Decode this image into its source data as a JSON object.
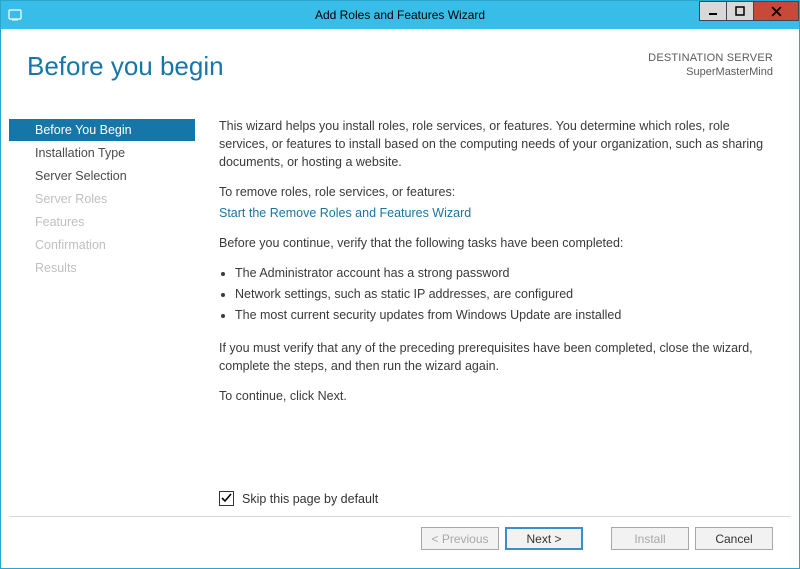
{
  "window": {
    "title": "Add Roles and Features Wizard"
  },
  "header": {
    "page_title": "Before you begin",
    "destination_label": "DESTINATION SERVER",
    "destination_value": "SuperMasterMind"
  },
  "nav": {
    "items": [
      {
        "label": "Before You Begin",
        "state": "selected"
      },
      {
        "label": "Installation Type",
        "state": "enabled"
      },
      {
        "label": "Server Selection",
        "state": "enabled"
      },
      {
        "label": "Server Roles",
        "state": "disabled"
      },
      {
        "label": "Features",
        "state": "disabled"
      },
      {
        "label": "Confirmation",
        "state": "disabled"
      },
      {
        "label": "Results",
        "state": "disabled"
      }
    ]
  },
  "content": {
    "intro": "This wizard helps you install roles, role services, or features. You determine which roles, role services, or features to install based on the computing needs of your organization, such as sharing documents, or hosting a website.",
    "remove_label": "To remove roles, role services, or features:",
    "remove_link": "Start the Remove Roles and Features Wizard",
    "verify_label": "Before you continue, verify that the following tasks have been completed:",
    "bullets": [
      "The Administrator account has a strong password",
      "Network settings, such as static IP addresses, are configured",
      "The most current security updates from Windows Update are installed"
    ],
    "rerun": "If you must verify that any of the preceding prerequisites have been completed, close the wizard, complete the steps, and then run the wizard again.",
    "continue": "To continue, click Next.",
    "skip_label": "Skip this page by default",
    "skip_checked": true
  },
  "footer": {
    "previous": "< Previous",
    "next": "Next >",
    "install": "Install",
    "cancel": "Cancel"
  }
}
